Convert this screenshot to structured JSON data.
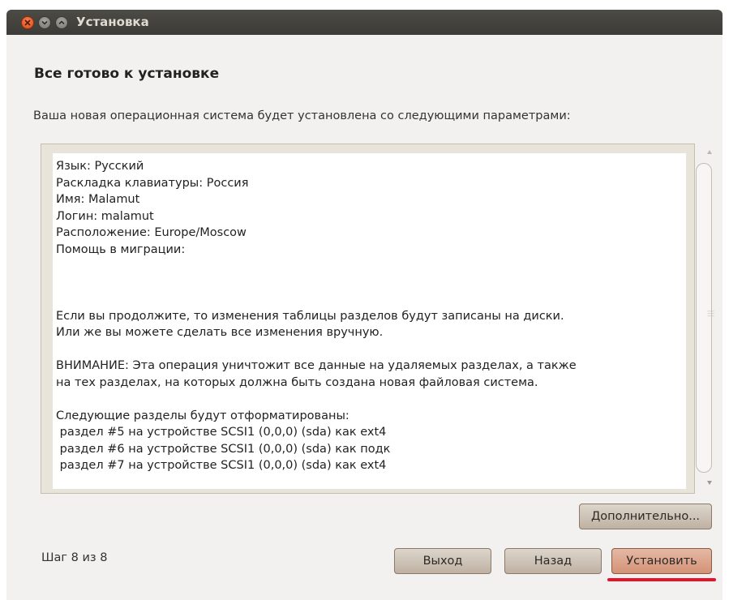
{
  "window": {
    "title": "Установка",
    "controls": [
      "close-icon",
      "minimize-icon",
      "maximize-icon"
    ]
  },
  "page": {
    "heading": "Все готово к установке",
    "intro": "Ваша новая операционная система будет установлена со следующими параметрами:"
  },
  "summary": {
    "lines": [
      "Язык: Русский",
      "Раскладка клавиатуры: Россия",
      "Имя: Malamut",
      "Логин: malamut",
      "Расположение: Europe/Moscow",
      "Помощь в миграции:",
      "",
      "",
      "",
      "Если вы продолжите, то изменения таблицы разделов будут записаны на диски.",
      "Или же вы можете сделать все изменения вручную.",
      "",
      "ВНИМАНИЕ: Эта операция уничтожит все данные на удаляемых разделах, а также",
      "на тех разделах, на которых должна быть создана новая файловая система.",
      "",
      "Следующие разделы будут отформатированы:",
      " раздел #5 на устройстве SCSI1 (0,0,0) (sda) как ext4",
      " раздел #6 на устройстве SCSI1 (0,0,0) (sda) как подк",
      " раздел #7 на устройстве SCSI1 (0,0,0) (sda) как ext4"
    ]
  },
  "buttons": {
    "advanced": "Дополнительно...",
    "quit": "Выход",
    "back": "Назад",
    "install": "Установить"
  },
  "footer": {
    "step": "Шаг 8 из 8"
  },
  "colors": {
    "titlebar": "#3c3b37",
    "background": "#f2f1f0",
    "install_button": "#d49276",
    "annotation_underline": "#e3142c"
  }
}
